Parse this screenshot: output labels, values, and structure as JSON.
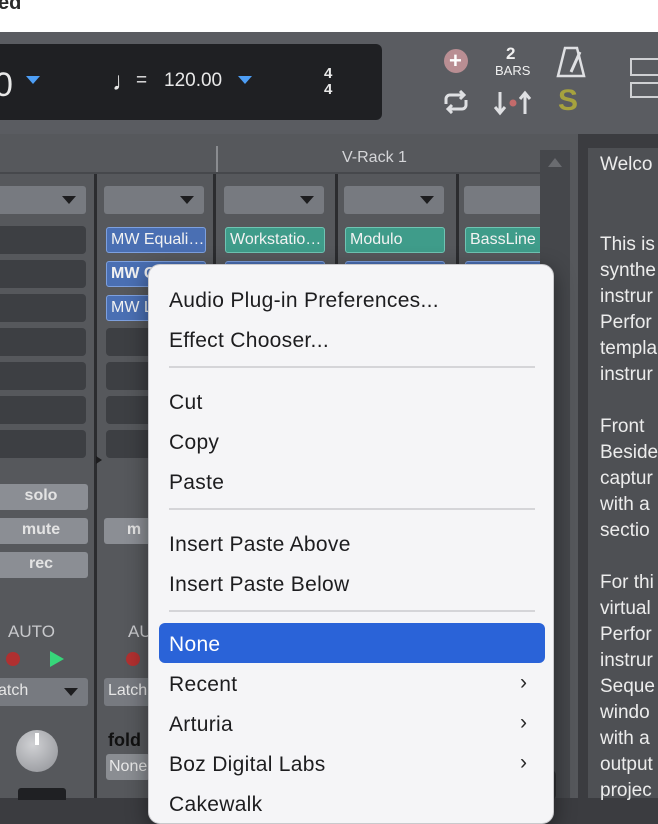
{
  "window": {
    "title_fragment": "ed"
  },
  "transport": {
    "position_fragment": "0",
    "tempo_equals": "=",
    "tempo": "120.00",
    "time_sig_top": "4",
    "time_sig_bottom": "4",
    "bars_count": "2",
    "bars_label": "BARS",
    "solo_s": "S"
  },
  "rack": {
    "title": "V-Rack 1"
  },
  "channels": {
    "ch2_plugins": [
      "MW Equali…",
      "MW C",
      "MW L"
    ],
    "rack_plugins": [
      "Workstatio…",
      "Modulo",
      "BassLine"
    ],
    "buttons": {
      "solo": "solo",
      "mute": "mute",
      "rec": "rec",
      "mute_partial": "m"
    },
    "auto_label": "AUTO",
    "auto_label_partial": "AU",
    "latch": "atch",
    "latch2": "Latch",
    "folder_label": "fold",
    "none_label": "None",
    "meter_fragment": "-∞"
  },
  "right_panel": {
    "welcome": "Welco",
    "lines": [
      "This is",
      "synthe",
      "instrur",
      "Perfor",
      "templa",
      "instrur",
      "",
      "Front",
      "Beside",
      "captur",
      "with a",
      "sectio",
      "",
      "For thi",
      "virtual",
      "Perfor",
      "instrur",
      "Seque",
      "windo",
      "with a",
      "output",
      "projec"
    ]
  },
  "context_menu": {
    "items": {
      "audio_prefs": "Audio Plug-in Preferences...",
      "effect_chooser": "Effect Chooser...",
      "cut": "Cut",
      "copy": "Copy",
      "paste": "Paste",
      "insert_above": "Insert Paste Above",
      "insert_below": "Insert Paste Below",
      "none": "None",
      "recent": "Recent",
      "arturia": "Arturia",
      "boz": "Boz Digital Labs",
      "next_partial": "Cakewalk"
    },
    "chevron": "›"
  },
  "colors": {
    "selection": "#2a63d8",
    "accent_blue": "#4d9ef5",
    "plugin_blue": "#4a6fb3",
    "plugin_green": "#3f9c8a",
    "play_green": "#37d67a",
    "rec_red": "#b03030"
  }
}
